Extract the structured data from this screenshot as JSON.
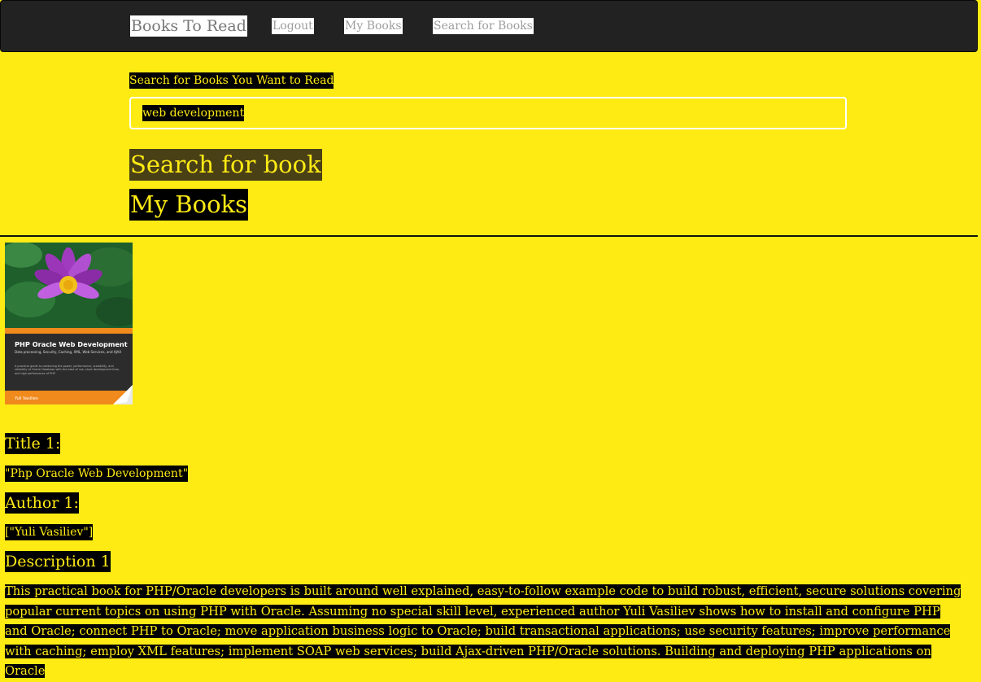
{
  "navbar": {
    "brand": "Books To Read",
    "links": [
      "Logout",
      "My Books",
      "Search for Books"
    ]
  },
  "search": {
    "label": "Search for Books You Want to Read",
    "value": "web development",
    "submit_label": "Search for book",
    "my_books_label": "My Books"
  },
  "result": {
    "cover": {
      "title": "PHP Oracle Web Development",
      "subtitle": "Data processing, Security, Caching, XML, Web Services, and AJAX",
      "blurb": "A practical guide to combining the power, performance, scalability, and reliability of Oracle Database with the ease of use, short development time, and high performance of PHP",
      "author": "Yuli Vasiliev"
    },
    "title_heading": "Title 1:",
    "title_value": "\"Php Oracle Web Development\"",
    "author_heading": "Author 1:",
    "author_value": "[\"Yuli Vasiliev\"]",
    "description_heading": "Description 1",
    "description": "This practical book for PHP/Oracle developers is built around well explained, easy-to-follow example code to build robust, efficient, secure solutions covering popular current topics on using PHP with Oracle. Assuming no special skill level, experienced author Yuli Vasiliev shows how to install and configure PHP and Oracle; connect PHP to Oracle; move application business logic to Oracle; build transactional applications; use security features; improve performance with caching; employ XML features; implement SOAP web services; build Ajax-driven PHP/Oracle solutions. Building and deploying PHP applications on Oracle"
  },
  "colors": {
    "background": "#ffeb14",
    "navbar": "#222222",
    "highlight": "#000000",
    "search_button": "#4a4016"
  }
}
